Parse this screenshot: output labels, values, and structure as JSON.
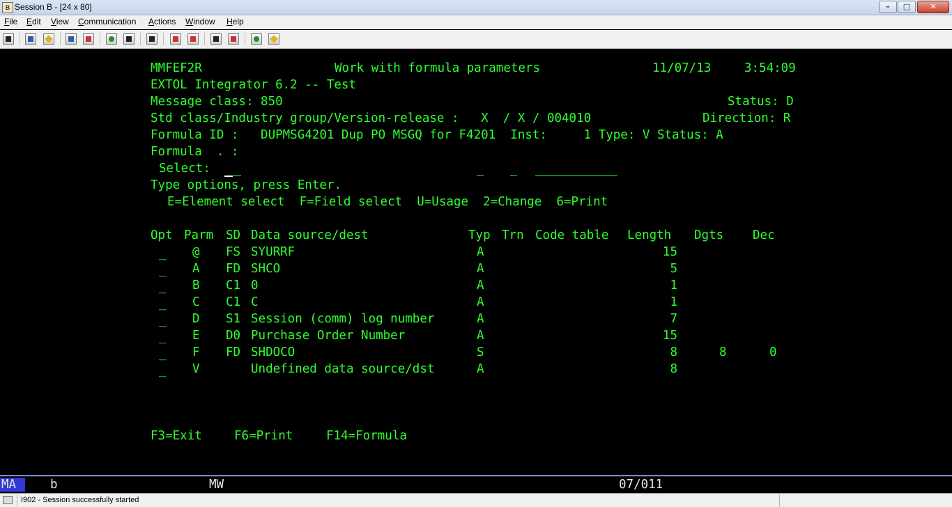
{
  "window": {
    "title": "Session B - [24 x 80]",
    "app_icon_text": "B",
    "controls": [
      "–",
      "□",
      "✕"
    ]
  },
  "menu": [
    {
      "accel": "F",
      "rest": "ile"
    },
    {
      "accel": "E",
      "rest": "dit"
    },
    {
      "accel": "V",
      "rest": "iew"
    },
    {
      "accel": "C",
      "rest": "ommunication"
    },
    {
      "accel": "A",
      "rest": "ctions"
    },
    {
      "accel": "W",
      "rest": "indow"
    },
    {
      "accel": "H",
      "rest": "elp"
    }
  ],
  "toolbar": [
    "print-screen-icon",
    "copy-icon",
    "paste-icon",
    "send-icon",
    "receive-icon",
    "display-icon",
    "keyboard-icon",
    "macro-icon",
    "record-macro-icon",
    "stop-macro-icon",
    "play-macro-icon",
    "file-transfer-icon",
    "globe-icon",
    "tag-icon"
  ],
  "screen": {
    "header": {
      "program": "MMFEF2R",
      "title": "Work with formula parameters",
      "date": "11/07/13",
      "time": "3:54:09",
      "line2": "EXTOL Integrator 6.2 -- Test",
      "message_class": "Message class: 850",
      "status_top": "Status: D",
      "std_line": "Std class/Industry group/Version-release :   X  / X / 004010",
      "direction": "Direction: R",
      "formula_id": "Formula ID :   DUPMSG4201 Dup PO MSGQ for F4201  Inst:     1 Type: V Status: A",
      "formula": "Formula  . :",
      "select_label": "Select:"
    },
    "instructions": "Type options, press Enter.",
    "options": "E=Element select  F=Field select  U=Usage  2=Change  6=Print",
    "columns": {
      "opt": "Opt",
      "parm": "Parm",
      "sd": "SD",
      "source": "Data source/dest",
      "typ": "Typ",
      "trn": "Trn",
      "code": "Code table",
      "length": "Length",
      "dgts": "Dgts",
      "dec": "Dec"
    },
    "rows": [
      {
        "opt": "_",
        "parm": "@",
        "sd": "FS",
        "source": "SYURRF",
        "typ": "A",
        "length": "15",
        "dgts": "",
        "dec": ""
      },
      {
        "opt": "_",
        "parm": "A",
        "sd": "FD",
        "source": "SHCO",
        "typ": "A",
        "length": "5",
        "dgts": "",
        "dec": ""
      },
      {
        "opt": "_",
        "parm": "B",
        "sd": "C1",
        "source": "0",
        "typ": "A",
        "length": "1",
        "dgts": "",
        "dec": ""
      },
      {
        "opt": "_",
        "parm": "C",
        "sd": "C1",
        "source": "C",
        "typ": "A",
        "length": "1",
        "dgts": "",
        "dec": ""
      },
      {
        "opt": "_",
        "parm": "D",
        "sd": "S1",
        "source": "Session (comm) log number",
        "typ": "A",
        "length": "7",
        "dgts": "",
        "dec": ""
      },
      {
        "opt": "_",
        "parm": "E",
        "sd": "D0",
        "source": "Purchase Order Number",
        "typ": "A",
        "length": "15",
        "dgts": "",
        "dec": ""
      },
      {
        "opt": "_",
        "parm": "F",
        "sd": "FD",
        "source": "SHDOCO",
        "typ": "S",
        "length": "8",
        "dgts": "8",
        "dec": "0"
      },
      {
        "opt": "_",
        "parm": "V",
        "sd": "",
        "source": "Undefined data source/dst",
        "typ": "A",
        "length": "8",
        "dgts": "",
        "dec": ""
      }
    ],
    "fkeys": [
      "F3=Exit",
      "F6=Print",
      "F14=Formula"
    ]
  },
  "oia": {
    "mode": "MA",
    "indicator": "b",
    "lock": "MW",
    "cursor_pos": "07/011"
  },
  "status_bar": {
    "message": "I902 - Session successfully started"
  }
}
